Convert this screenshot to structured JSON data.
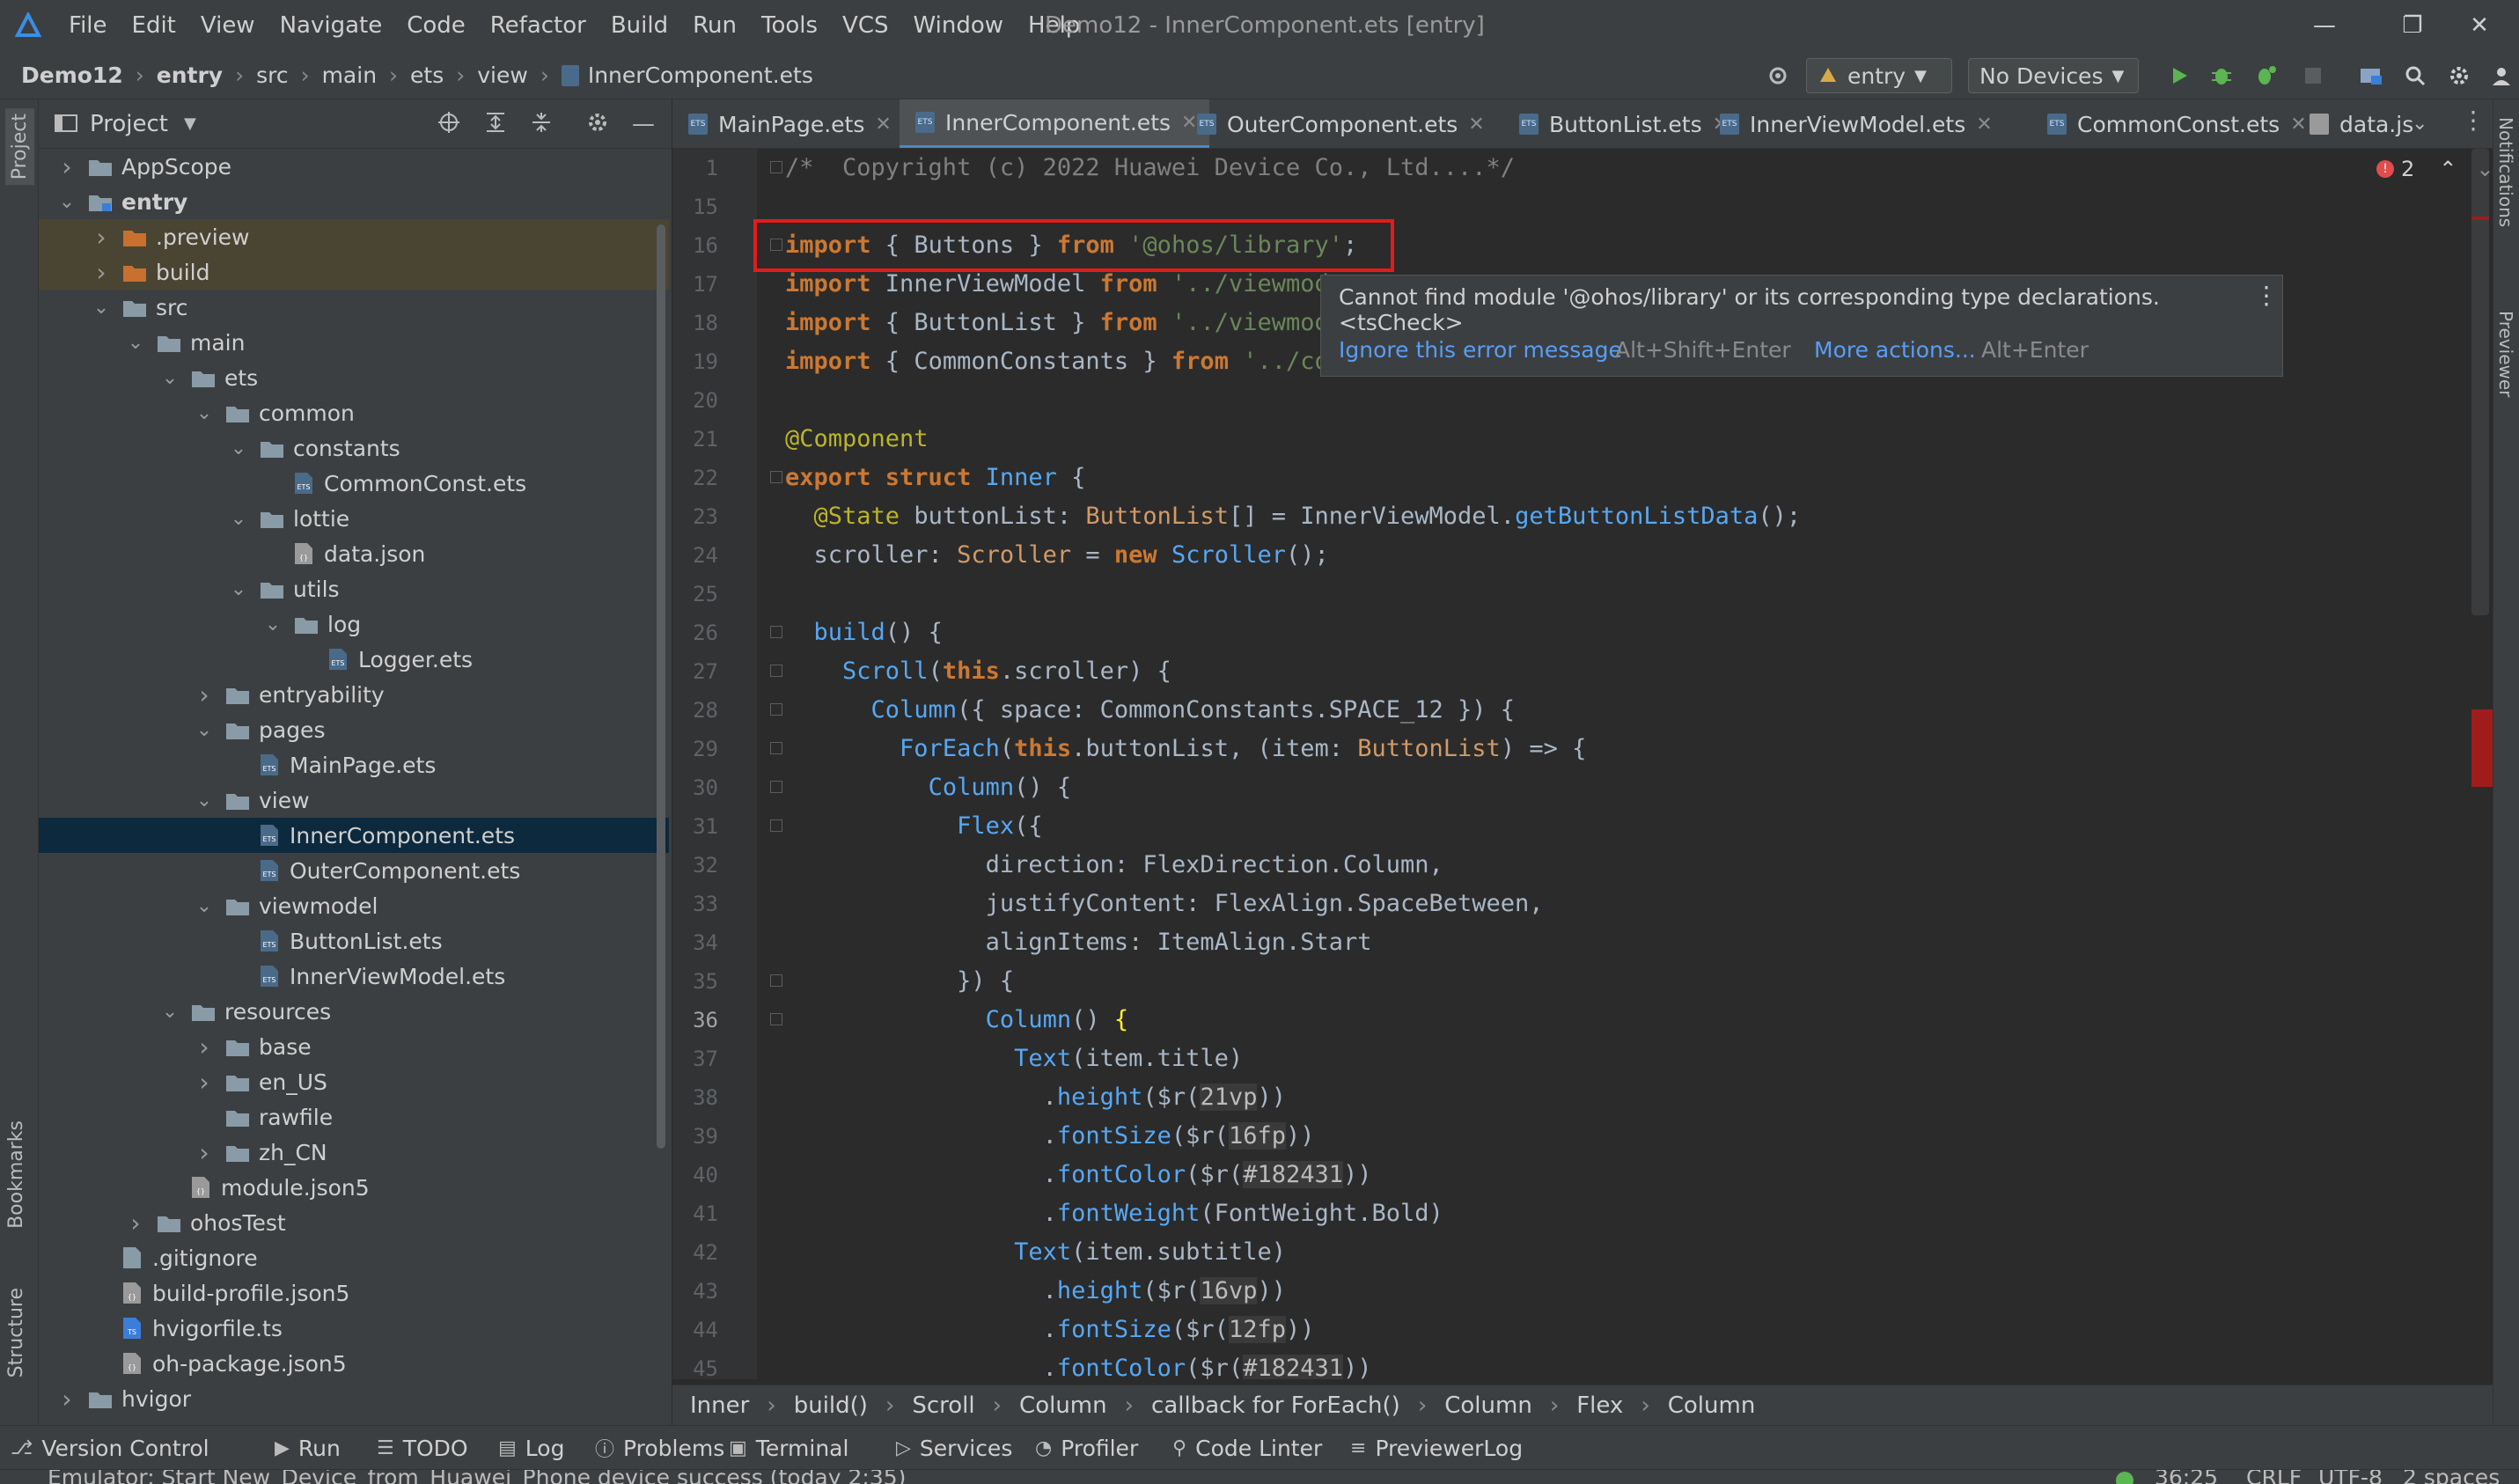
{
  "app": {
    "title": "Demo12 - InnerComponent.ets [entry]",
    "menu": [
      "File",
      "Edit",
      "View",
      "Navigate",
      "Code",
      "Refactor",
      "Build",
      "Run",
      "Tools",
      "VCS",
      "Window",
      "Help"
    ]
  },
  "navbar": {
    "crumbs": [
      "Demo12",
      "entry",
      "src",
      "main",
      "ets",
      "view",
      "InnerComponent.ets"
    ],
    "run_config": "entry",
    "device": "No Devices"
  },
  "left_strip": {
    "project": "Project",
    "bookmarks": "Bookmarks",
    "structure": "Structure"
  },
  "right_strip": {
    "notifications": "Notifications",
    "previewer": "Previewer"
  },
  "project_panel": {
    "title": "Project",
    "tree": [
      {
        "label": "AppScope",
        "depth": 0,
        "type": "folder",
        "arrow": "right"
      },
      {
        "label": "entry",
        "depth": 0,
        "type": "module",
        "arrow": "down",
        "bold": true
      },
      {
        "label": ".preview",
        "depth": 1,
        "type": "folder-orange",
        "arrow": "right"
      },
      {
        "label": "build",
        "depth": 1,
        "type": "folder-orange",
        "arrow": "right"
      },
      {
        "label": "src",
        "depth": 1,
        "type": "folder",
        "arrow": "down"
      },
      {
        "label": "main",
        "depth": 2,
        "type": "folder",
        "arrow": "down"
      },
      {
        "label": "ets",
        "depth": 3,
        "type": "folder",
        "arrow": "down"
      },
      {
        "label": "common",
        "depth": 4,
        "type": "folder",
        "arrow": "down"
      },
      {
        "label": "constants",
        "depth": 5,
        "type": "folder",
        "arrow": "down"
      },
      {
        "label": "CommonConst.ets",
        "depth": 6,
        "type": "ets"
      },
      {
        "label": "lottie",
        "depth": 5,
        "type": "folder",
        "arrow": "down"
      },
      {
        "label": "data.json",
        "depth": 6,
        "type": "json"
      },
      {
        "label": "utils",
        "depth": 5,
        "type": "folder",
        "arrow": "down"
      },
      {
        "label": "log",
        "depth": 6,
        "type": "folder",
        "arrow": "down"
      },
      {
        "label": "Logger.ets",
        "depth": 7,
        "type": "ets"
      },
      {
        "label": "entryability",
        "depth": 4,
        "type": "folder",
        "arrow": "right"
      },
      {
        "label": "pages",
        "depth": 4,
        "type": "folder",
        "arrow": "down"
      },
      {
        "label": "MainPage.ets",
        "depth": 5,
        "type": "ets"
      },
      {
        "label": "view",
        "depth": 4,
        "type": "folder",
        "arrow": "down"
      },
      {
        "label": "InnerComponent.ets",
        "depth": 5,
        "type": "ets",
        "selected": true
      },
      {
        "label": "OuterComponent.ets",
        "depth": 5,
        "type": "ets"
      },
      {
        "label": "viewmodel",
        "depth": 4,
        "type": "folder",
        "arrow": "down"
      },
      {
        "label": "ButtonList.ets",
        "depth": 5,
        "type": "ets"
      },
      {
        "label": "InnerViewModel.ets",
        "depth": 5,
        "type": "ets"
      },
      {
        "label": "resources",
        "depth": 3,
        "type": "folder",
        "arrow": "down"
      },
      {
        "label": "base",
        "depth": 4,
        "type": "folder",
        "arrow": "right"
      },
      {
        "label": "en_US",
        "depth": 4,
        "type": "folder",
        "arrow": "right"
      },
      {
        "label": "rawfile",
        "depth": 4,
        "type": "folder"
      },
      {
        "label": "zh_CN",
        "depth": 4,
        "type": "folder",
        "arrow": "right"
      },
      {
        "label": "module.json5",
        "depth": 3,
        "type": "json5"
      },
      {
        "label": "ohosTest",
        "depth": 2,
        "type": "folder",
        "arrow": "right"
      },
      {
        "label": ".gitignore",
        "depth": 1,
        "type": "text"
      },
      {
        "label": "build-profile.json5",
        "depth": 1,
        "type": "json5"
      },
      {
        "label": "hvigorfile.ts",
        "depth": 1,
        "type": "ts"
      },
      {
        "label": "oh-package.json5",
        "depth": 1,
        "type": "json5"
      },
      {
        "label": "hvigor",
        "depth": 0,
        "type": "folder",
        "arrow": "right"
      }
    ]
  },
  "editor": {
    "tabs": [
      {
        "label": "MainPage.ets",
        "active": false
      },
      {
        "label": "InnerComponent.ets",
        "active": true
      },
      {
        "label": "OuterComponent.ets",
        "active": false
      },
      {
        "label": "ButtonList.ets",
        "active": false
      },
      {
        "label": "InnerViewModel.ets",
        "active": false
      },
      {
        "label": "CommonConst.ets",
        "active": false
      },
      {
        "label": "data.js",
        "active": false
      }
    ],
    "error_count": "2",
    "current_line": "36",
    "lines": [
      {
        "n": "1",
        "html": "<span class=\"cmt\">/*  Copyright (c) 2022 Huawei Device Co., Ltd....*/</span>"
      },
      {
        "n": "15",
        "html": ""
      },
      {
        "n": "16",
        "html": "<span class=\"kw\">import</span> { Buttons } <span class=\"kw\">from</span> <span class=\"str\">'@ohos/library'</span>;"
      },
      {
        "n": "17",
        "html": "<span class=\"kw\">import</span> InnerViewModel <span class=\"kw\">from</span> <span class=\"str\">'../viewmod</span>"
      },
      {
        "n": "18",
        "html": "<span class=\"kw\">import</span> { ButtonList } <span class=\"kw\">from</span> <span class=\"str\">'../viewmod</span>"
      },
      {
        "n": "19",
        "html": "<span class=\"kw\">import</span> { CommonConstants } <span class=\"kw\">from</span> <span class=\"str\">'../co</span>"
      },
      {
        "n": "20",
        "html": ""
      },
      {
        "n": "21",
        "html": "<span class=\"anno\">@Component</span>"
      },
      {
        "n": "22",
        "html": "<span class=\"kw\">export struct</span> <span class=\"fn\">Inner</span> {"
      },
      {
        "n": "23",
        "html": "  <span class=\"anno\">@State</span> buttonList: <span class=\"typ\">ButtonList</span>[] = InnerViewModel.<span class=\"fn\">getButtonListData</span>();"
      },
      {
        "n": "24",
        "html": "  scroller: <span class=\"typ\">Scroller</span> = <span class=\"kw\">new</span> <span class=\"fn\">Scroller</span>();"
      },
      {
        "n": "25",
        "html": ""
      },
      {
        "n": "26",
        "html": "  <span class=\"fn\">build</span>() {"
      },
      {
        "n": "27",
        "html": "    <span class=\"fn\">Scroll</span>(<span class=\"kw\">this</span>.scroller) {"
      },
      {
        "n": "28",
        "html": "      <span class=\"fn\">Column</span>({ space: CommonConstants.SPACE_12 }) {"
      },
      {
        "n": "29",
        "html": "        <span class=\"fn\">ForEach</span>(<span class=\"kw\">this</span>.buttonList, (item: <span class=\"typ\">ButtonList</span>) => {"
      },
      {
        "n": "30",
        "html": "          <span class=\"fn\">Column</span>() {"
      },
      {
        "n": "31",
        "html": "            <span class=\"fn\">Flex</span>({"
      },
      {
        "n": "32",
        "html": "              direction: FlexDirection.Column,"
      },
      {
        "n": "33",
        "html": "              justifyContent: FlexAlign.SpaceBetween,"
      },
      {
        "n": "34",
        "html": "              alignItems: ItemAlign.Start"
      },
      {
        "n": "35",
        "html": "            }) {"
      },
      {
        "n": "36",
        "html": "              <span class=\"fn\">Column</span>() <span style=\"color:#ffef28\">{</span>"
      },
      {
        "n": "37",
        "html": "                <span class=\"fn\">Text</span>(item.title)"
      },
      {
        "n": "38",
        "html": "                  .<span class=\"fn\">height</span>($r(<span class=\"res\">21vp</span>))"
      },
      {
        "n": "39",
        "html": "                  .<span class=\"fn\">fontSize</span>($r(<span class=\"res\">16fp</span>))"
      },
      {
        "n": "40",
        "html": "                  .<span class=\"fn\">fontColor</span>($r(<span class=\"res\">#182431</span>))"
      },
      {
        "n": "41",
        "html": "                  .<span class=\"fn\">fontWeight</span>(FontWeight.Bold)"
      },
      {
        "n": "42",
        "html": "                <span class=\"fn\">Text</span>(item.subtitle)"
      },
      {
        "n": "43",
        "html": "                  .<span class=\"fn\">height</span>($r(<span class=\"res\">16vp</span>))"
      },
      {
        "n": "44",
        "html": "                  .<span class=\"fn\">fontSize</span>($r(<span class=\"res\">12fp</span>))"
      },
      {
        "n": "45",
        "html": "                  .<span class=\"fn\">fontColor</span>($r(<span class=\"res\">#182431</span>))"
      }
    ]
  },
  "tooltip": {
    "message": "Cannot find module '@ohos/library' or its corresponding type declarations. <tsCheck>",
    "ignore_label": "Ignore this error message",
    "ignore_shortcut": "Alt+Shift+Enter",
    "more_label": "More actions...",
    "more_shortcut": "Alt+Enter"
  },
  "bottom_breadcrumb": [
    "Inner",
    "build()",
    "Scroll",
    "Column",
    "callback for ForEach()",
    "Column",
    "Flex",
    "Column"
  ],
  "tool_windows": [
    "Version Control",
    "Run",
    "TODO",
    "Log",
    "Problems",
    "Terminal",
    "Services",
    "Profiler",
    "Code Linter",
    "PreviewerLog"
  ],
  "status": {
    "message": "Emulator: Start New_Device_from_Huawei_Phone device success (today 2:35)",
    "position": "36:25",
    "line_sep": "CRLF",
    "encoding": "UTF-8",
    "indent": "2 spaces"
  }
}
